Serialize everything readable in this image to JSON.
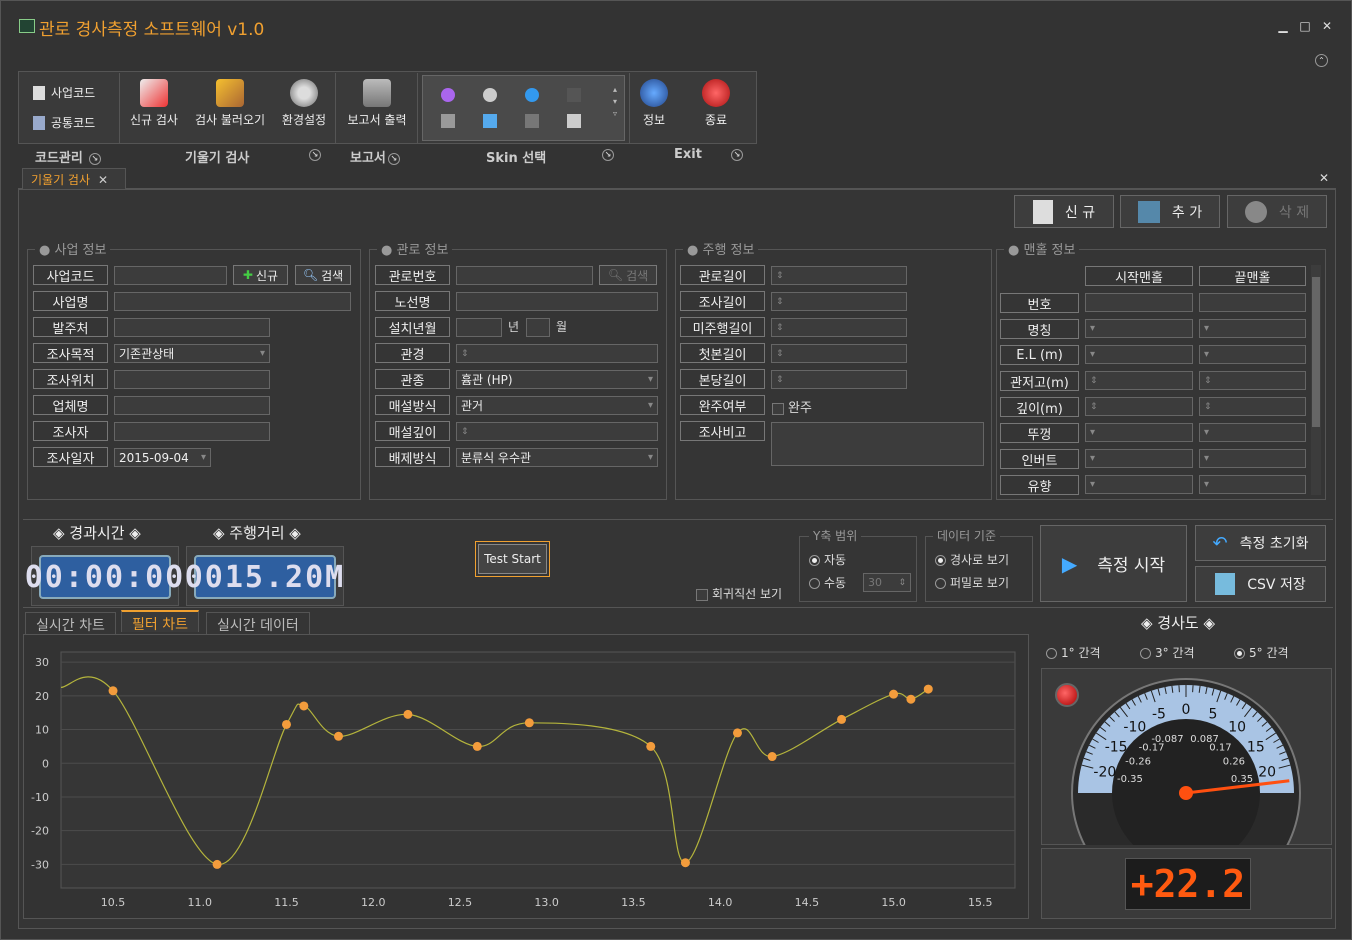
{
  "window": {
    "title": "관로 경사측정 소프트웨어 v1.0"
  },
  "ribbon": {
    "code": {
      "biz": "사업코드",
      "common": "공통코드",
      "group": "코드관리"
    },
    "gauge": {
      "new": "신규 검사",
      "load": "검사 불러오기",
      "settings": "환경설정",
      "group": "기울기 검사"
    },
    "report": {
      "print": "보고서 출력",
      "group": "보고서"
    },
    "skin": {
      "group": "Skin 선택"
    },
    "exit": {
      "info": "정보",
      "quit": "종료",
      "group": "Exit"
    }
  },
  "doc_tab": "기울기 검사",
  "top_buttons": {
    "new": "신 규",
    "add": "추 가",
    "delete": "삭 제"
  },
  "business": {
    "title": "사업 정보",
    "labels": [
      "사업코드",
      "사업명",
      "발주처",
      "조사목적",
      "조사위치",
      "업체명",
      "조사자",
      "조사일자"
    ],
    "new_btn": "신규",
    "search_btn": "검색",
    "purpose": "기존관상태",
    "date": "2015-09-04"
  },
  "pipe": {
    "title": "관로 정보",
    "labels": [
      "관로번호",
      "노선명",
      "설치년월",
      "관경",
      "관종",
      "매설방식",
      "매설깊이",
      "배제방식"
    ],
    "search_btn": "검색",
    "year": "년",
    "month": "월",
    "type": "흄관 (HP)",
    "burial": "관거",
    "drain": "분류식 우수관"
  },
  "drive": {
    "title": "주행 정보",
    "labels": [
      "관로길이",
      "조사길이",
      "미주행길이",
      "첫본길이",
      "본당길이",
      "완주여부",
      "조사비고"
    ],
    "complete": "완주"
  },
  "manhole": {
    "title": "맨홀 정보",
    "start": "시작맨홀",
    "end": "끝맨홀",
    "labels": [
      "번호",
      "명칭",
      "E.L (m)",
      "관저고(m)",
      "깊이(m)",
      "뚜껑",
      "인버트",
      "유향"
    ]
  },
  "elapsed": {
    "title": "◈ 경과시간 ◈",
    "value": "00:00:00"
  },
  "distance": {
    "title": "◈ 주행거리 ◈",
    "value": "0015.20M"
  },
  "test_start": "Test Start",
  "regression": "회귀직선 보기",
  "yaxis": {
    "title": "Y축 범위",
    "auto": "자동",
    "manual": "수동",
    "value": "30"
  },
  "basis": {
    "title": "데이터 기준",
    "pipe": "경사로 보기",
    "percent": "퍼밀로 보기"
  },
  "measure_start": "측정 시작",
  "reset": "측정 초기화",
  "csv": "CSV 저장",
  "chart_tabs": [
    "실시간 차트",
    "필터 차트",
    "실시간 데이터"
  ],
  "slope": {
    "title": "◈ 경사도 ◈",
    "opt1": "1° 간격",
    "opt3": "3° 간격",
    "opt5": "5° 간격",
    "readout": "+22.2",
    "outer_ticks": [
      "-20",
      "-15",
      "-10",
      "-5",
      "0",
      "5",
      "10",
      "15",
      "20"
    ],
    "inner_ticks": [
      "-0.35",
      "-0.26",
      "-0.17",
      "-0.087",
      "0.087",
      "0.17",
      "0.26",
      "0.35"
    ]
  },
  "chart_data": {
    "type": "line",
    "x": [
      10.5,
      11.1,
      11.5,
      11.6,
      11.8,
      12.2,
      12.6,
      12.9,
      13.6,
      13.8,
      14.1,
      14.3,
      14.7,
      15.0,
      15.1,
      15.2
    ],
    "y": [
      21.5,
      -30,
      11.5,
      17,
      8,
      14.5,
      5,
      12,
      5,
      -29.5,
      9,
      2,
      13,
      20.5,
      19,
      22
    ],
    "xlim": [
      10.2,
      15.7
    ],
    "ylim": [
      -37,
      33
    ],
    "xticks": [
      "10.5",
      "11.0",
      "11.5",
      "12.0",
      "12.5",
      "13.0",
      "13.5",
      "14.0",
      "14.5",
      "15.0",
      "15.5"
    ],
    "yticks": [
      "30",
      "20",
      "10",
      "0",
      "-10",
      "-20",
      "-30"
    ],
    "line_color": "#b4b43c",
    "point_color": "#f39c3c"
  }
}
